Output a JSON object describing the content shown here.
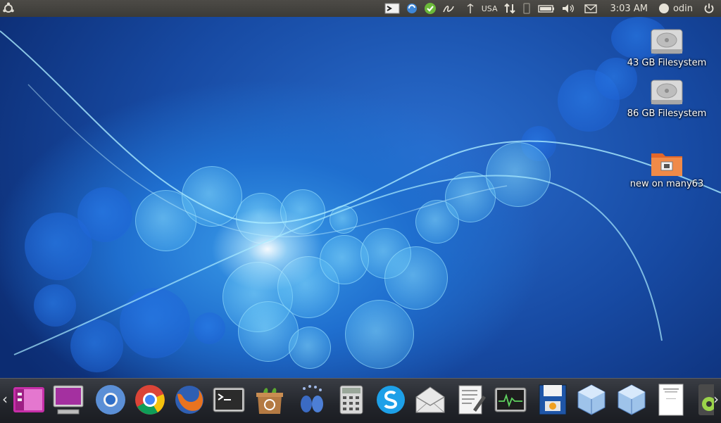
{
  "top_panel": {
    "keyboard_layout": "USA",
    "clock": "3:03 AM",
    "user": "odin"
  },
  "desktop": {
    "icons": [
      {
        "label": "43 GB Filesystem",
        "icon": "harddisk-icon"
      },
      {
        "label": "86 GB Filesystem",
        "icon": "harddisk-icon"
      },
      {
        "label": "new on many63",
        "icon": "network-folder-icon"
      }
    ]
  },
  "dock": {
    "items": [
      "workspace-switcher-icon",
      "computer-icon",
      "chromium-icon",
      "chrome-icon",
      "firefox-icon",
      "terminal-icon",
      "software-center-icon",
      "pidgin-icon",
      "calculator-icon",
      "skype-icon",
      "mail-icon",
      "text-editor-icon",
      "system-monitor-icon",
      "diskette-icon",
      "virtualbox-icon",
      "virtualbox-icon",
      "document-icon",
      "rhythmbox-icon"
    ]
  },
  "colors": {
    "panel": "#3c3b37",
    "panel_text": "#dfdbd2",
    "wallpaper_blue": "#1f6fcf",
    "dock": "#22252b"
  }
}
